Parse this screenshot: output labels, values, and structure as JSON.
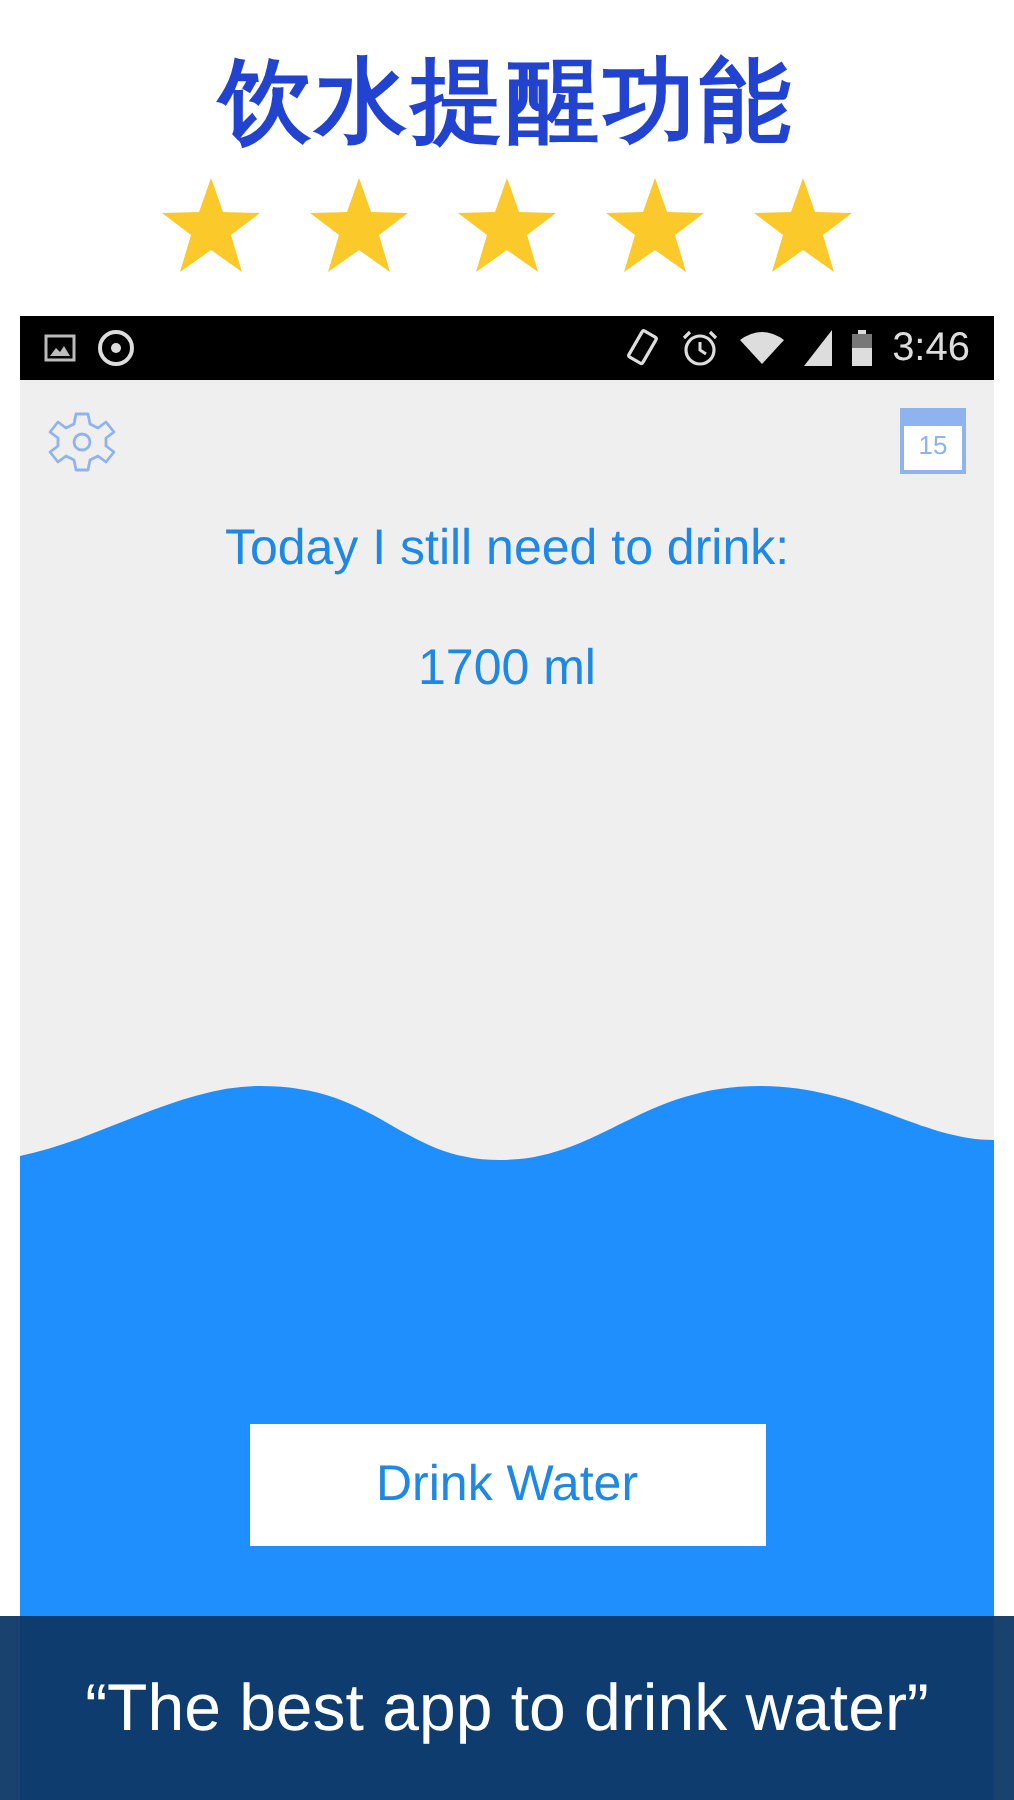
{
  "headline": "饮水提醒功能",
  "rating": {
    "stars": 5
  },
  "status_bar": {
    "time": "3:46"
  },
  "calendar": {
    "day": "15"
  },
  "message": "Today I still need to drink:",
  "remaining": "1700 ml",
  "button": "Drink Water",
  "banner": "“The best app to drink water”"
}
